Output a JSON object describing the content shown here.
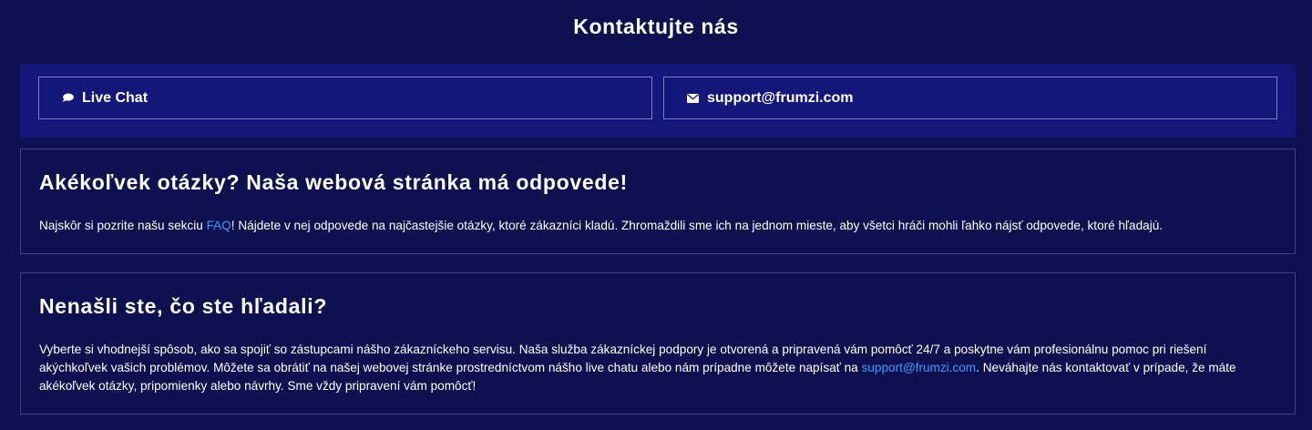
{
  "page": {
    "title": "Kontaktujte nás"
  },
  "contact": {
    "live_chat_label": "Live Chat",
    "email_label": "support@frumzi.com"
  },
  "faq_card": {
    "heading": "Akékoľvek otázky? Naša webová stránka má odpovede!",
    "text_before": "Najskôr si pozrite našu sekciu ",
    "link_text": "FAQ",
    "text_after": "! Nájdete v nej odpovede na najčastejšie otázky, ktoré zákazníci kladú. Zhromaždili sme ich na jednom mieste, aby všetci hráči mohli ľahko nájsť odpovede, ktoré hľadajú."
  },
  "help_card": {
    "heading": "Nenašli ste, čo ste hľadali?",
    "text_before": "Vyberte si vhodnejší spôsob, ako sa spojiť so zástupcami nášho zákazníckeho servisu. Naša služba zákazníckej podpory je otvorená a pripravená vám pomôcť 24/7 a poskytne vám profesionálnu pomoc pri riešení akýchkoľvek vašich problémov. Môžete sa obrátiť na našej webovej stránke prostredníctvom nášho live chatu alebo nám prípadne môžete napísať na ",
    "link_text": "support@frumzi.com",
    "text_after": ". Neváhajte nás kontaktovať v prípade, že máte akékoľvek otázky, pripomienky alebo návrhy. Sme vždy pripravení vám pomôcť!"
  },
  "icons": {
    "chat": "chat-bubble-icon",
    "mail": "envelope-icon"
  },
  "colors": {
    "background": "#0e1050",
    "contact_bar": "#141679",
    "link": "#3d9bff",
    "border": "#3f4386"
  }
}
